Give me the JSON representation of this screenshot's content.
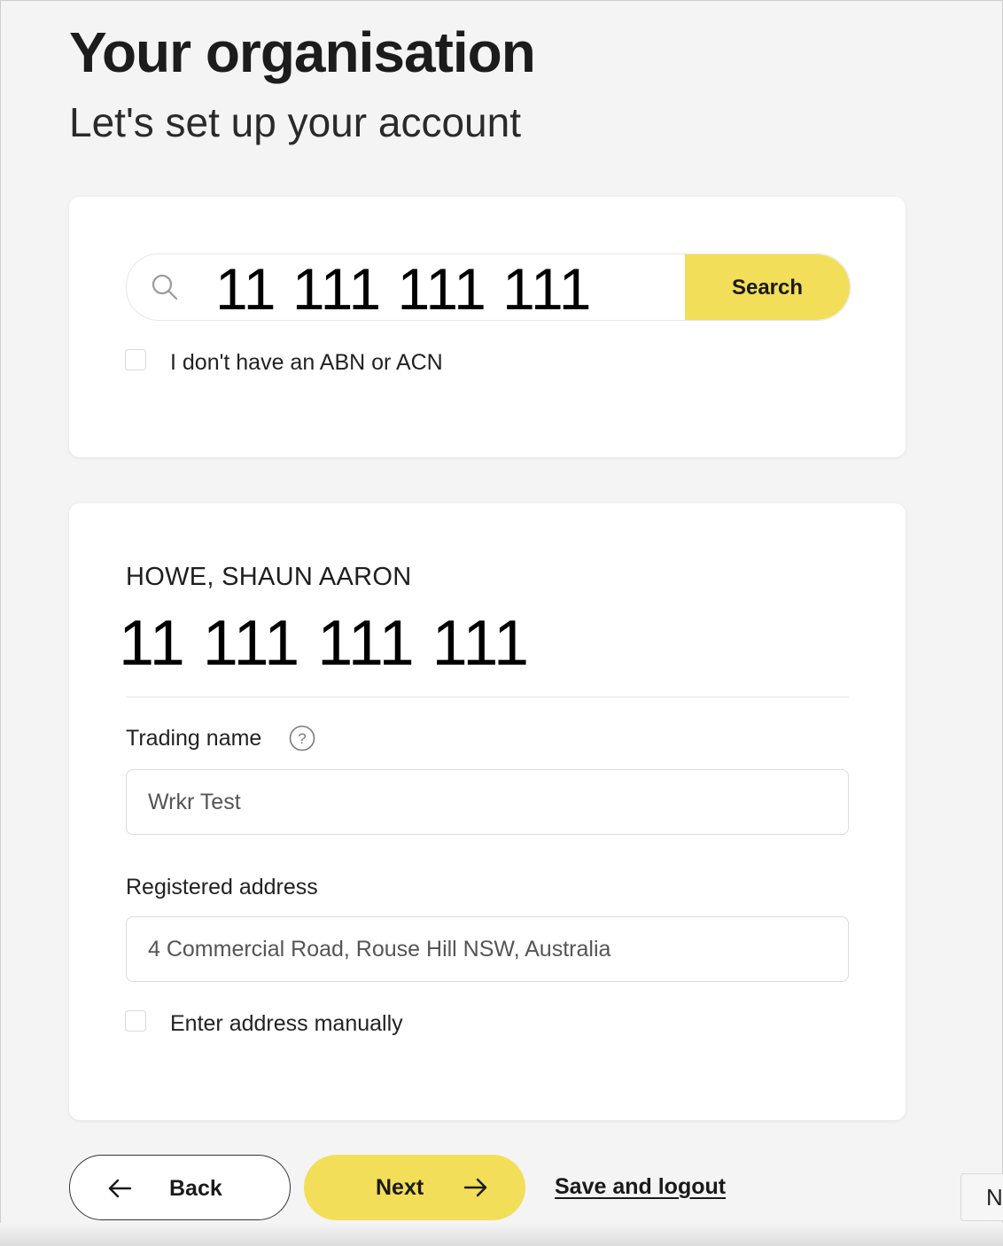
{
  "header": {
    "title": "Your organisation",
    "subtitle": "Let's set up your account"
  },
  "search": {
    "value": "11 111 111 111",
    "button_label": "Search",
    "no_abn_label": "I don't have an ABN or ACN",
    "no_abn_checked": false
  },
  "entity": {
    "name": "HOWE, SHAUN AARON",
    "number": "11 111 111 111"
  },
  "form": {
    "trading_name_label": "Trading name",
    "trading_name_value": "Wrkr Test",
    "address_label": "Registered address",
    "address_value": "4 Commercial Road, Rouse Hill NSW, Australia",
    "manual_address_label": "Enter address manually",
    "manual_address_checked": false
  },
  "footer": {
    "back_label": "Back",
    "next_label": "Next",
    "save_logout_label": "Save and logout",
    "edge_widget_text": "N"
  },
  "colors": {
    "accent": "#f2de58",
    "background": "#f4f4f4",
    "card": "#ffffff"
  },
  "icons": {
    "search": "search-icon",
    "help": "help-circle-icon",
    "back": "arrow-left-icon",
    "next": "arrow-right-icon"
  }
}
